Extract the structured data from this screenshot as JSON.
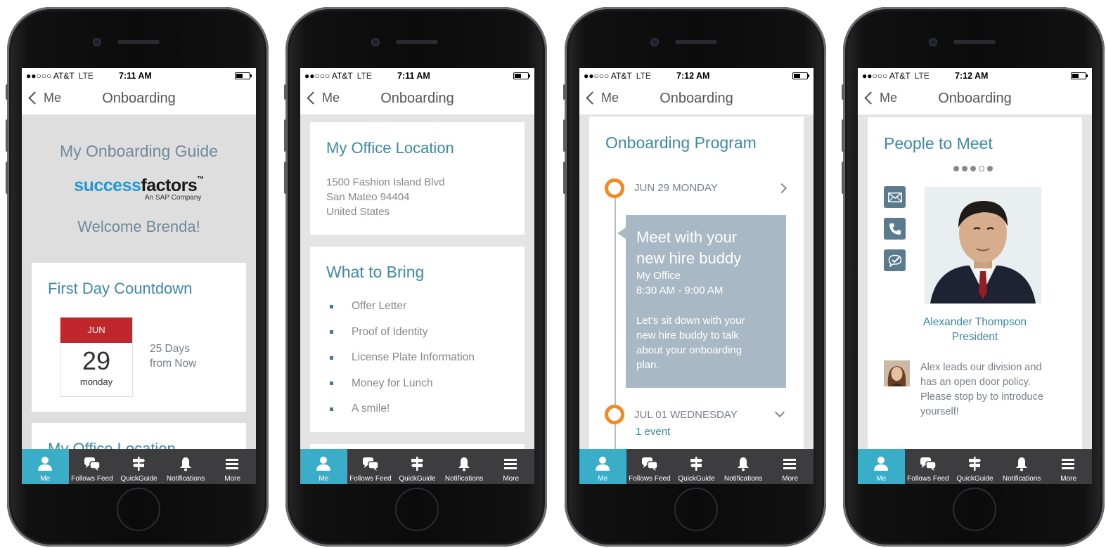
{
  "status": {
    "carrier": "●●○○○ AT&T",
    "network": "LTE",
    "times": [
      "7:11 AM",
      "7:11 AM",
      "7:12 AM",
      "7:12 AM"
    ]
  },
  "nav": {
    "back_label": "Me",
    "title": "Onboarding"
  },
  "tabs": [
    {
      "label": "Me",
      "icon": "person-icon"
    },
    {
      "label": "Follows Feed",
      "icon": "chat-bubbles-icon"
    },
    {
      "label": "QuickGuide",
      "icon": "signpost-icon"
    },
    {
      "label": "Notifications",
      "icon": "bell-icon"
    },
    {
      "label": "More",
      "icon": "hamburger-icon"
    }
  ],
  "screen1": {
    "guide_title": "My Onboarding Guide",
    "logo": {
      "part1": "success",
      "part2": "factors",
      "tm": "™",
      "sub": "An SAP Company",
      "heart_color": "#e0202e"
    },
    "welcome": "Welcome Brenda!",
    "countdown": {
      "title": "First Day Countdown",
      "month": "JUN",
      "day": "29",
      "weekday": "monday",
      "days_line1": "25 Days",
      "days_line2": "from Now"
    },
    "next_card_title": "My Office Location"
  },
  "screen2": {
    "office": {
      "title": "My Office Location",
      "lines": [
        "1500 Fashion Island Blvd",
        "San Mateo 94404",
        "United States"
      ]
    },
    "bring": {
      "title": "What to Bring",
      "items": [
        "Offer Letter",
        "Proof of Identity",
        "License Plate Information",
        "Money for Lunch",
        "A smile!"
      ]
    }
  },
  "screen3": {
    "title": "Onboarding Program",
    "date1": "JUN 29 MONDAY",
    "event": {
      "title_line1": "Meet with your",
      "title_line2": "new hire buddy",
      "location": "My Office",
      "time": "8:30 AM - 9:00 AM",
      "desc_lines": [
        "Let's sit down with your",
        "new hire buddy to talk",
        "about your onboarding",
        "plan."
      ]
    },
    "date2": "JUL 01 WEDNESDAY",
    "date2_events": "1 event"
  },
  "screen4": {
    "title": "People to Meet",
    "pager": {
      "count": 5,
      "active": 3
    },
    "person": {
      "name": "Alexander Thompson",
      "role": "President"
    },
    "quote_lines": [
      "Alex leads our division and",
      "has an open door policy.",
      "Please stop by to introduce",
      "yourself!"
    ]
  },
  "colors": {
    "teal": "#3d8aa3",
    "accent_tab": "#3aaec9",
    "timeline_orange": "#f08a24",
    "event_bg": "#a8b8c4",
    "calendar_red": "#c0272d"
  }
}
